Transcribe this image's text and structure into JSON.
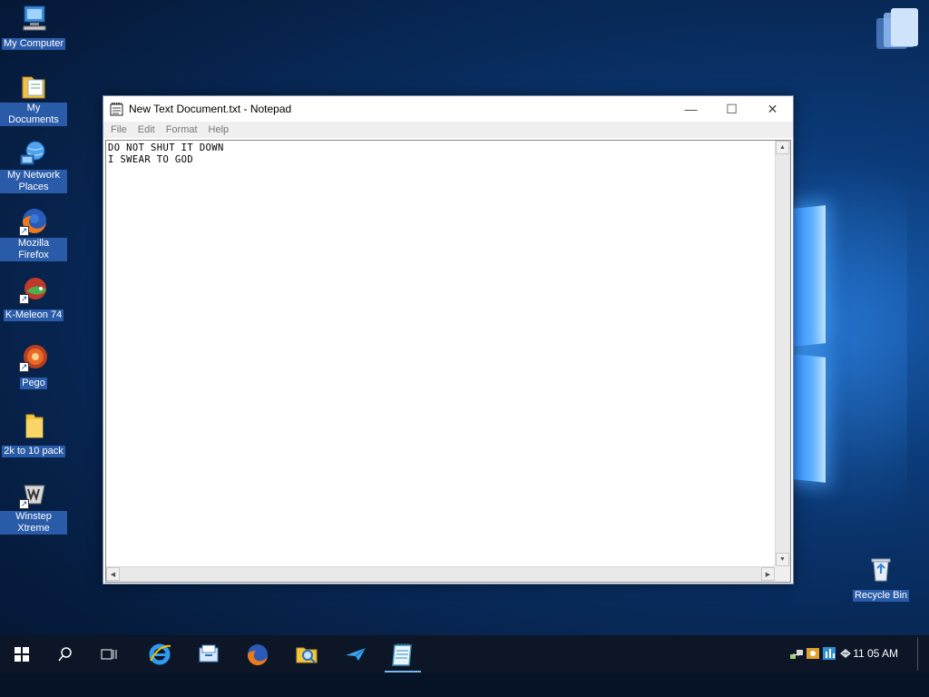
{
  "desktop": {
    "icons": [
      {
        "label": "My Computer"
      },
      {
        "label": "My Documents"
      },
      {
        "label": "My Network Places"
      },
      {
        "label": "Mozilla Firefox"
      },
      {
        "label": "K-Meleon 74"
      },
      {
        "label": "Pego"
      },
      {
        "label": "2k to 10 pack"
      },
      {
        "label": "Winstep Xtreme"
      }
    ],
    "recycle_bin": {
      "label": "Recycle Bin"
    }
  },
  "notepad": {
    "title": "New Text Document.txt - Notepad",
    "menu": [
      "File",
      "Edit",
      "Format",
      "Help"
    ],
    "content": "DO NOT SHUT IT DOWN\nI SWEAR TO GOD",
    "controls": {
      "minimize": "—",
      "maximize": "☐",
      "close": "✕"
    }
  },
  "taskbar": {
    "clock": "11 05 AM"
  },
  "colors": {
    "desktop_bg": "#082a5a",
    "taskbar": "#0c1626",
    "label_bg": "#2a5ba8",
    "accent": "#76b9ed"
  }
}
